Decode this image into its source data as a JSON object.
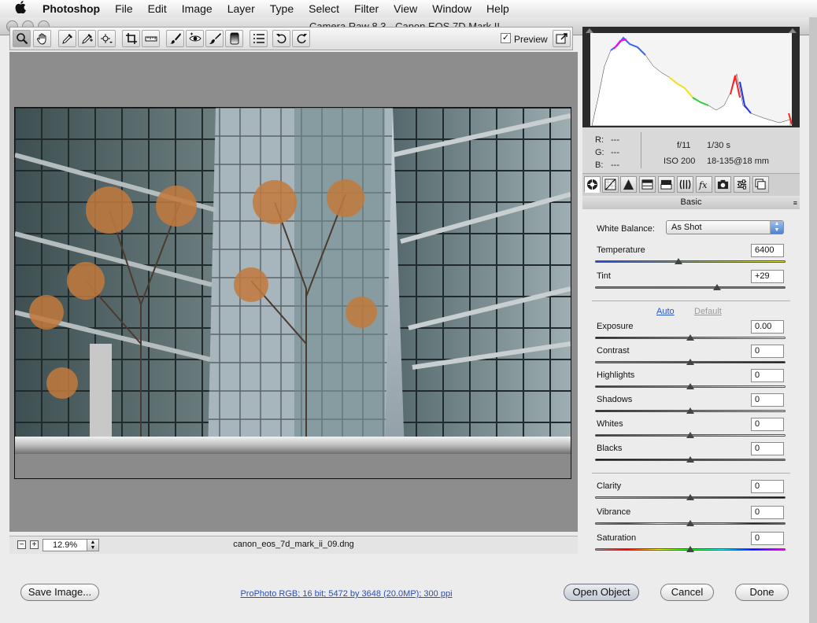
{
  "menubar": {
    "apple": "",
    "items": [
      "Photoshop",
      "File",
      "Edit",
      "Image",
      "Layer",
      "Type",
      "Select",
      "Filter",
      "View",
      "Window",
      "Help"
    ]
  },
  "window": {
    "title": "Camera Raw 8.3  -  Canon EOS 7D Mark II"
  },
  "toolbar": {
    "tools": [
      "zoom-tool",
      "hand-tool",
      "white-balance-tool",
      "color-sampler-tool",
      "targeted-adjustment-tool",
      "crop-tool",
      "straighten-tool",
      "spot-removal-tool",
      "red-eye-removal-tool",
      "adjustment-brush",
      "graduated-filter",
      "preferences",
      "rotate-left",
      "rotate-right"
    ],
    "preview_label": "Preview",
    "preview_checked": true
  },
  "status": {
    "zoom": "12.9%",
    "filename": "canon_eos_7d_mark_ii_09.dng"
  },
  "info": {
    "r_label": "R:",
    "r_value": "---",
    "g_label": "G:",
    "g_value": "---",
    "b_label": "B:",
    "b_value": "---",
    "aperture": "f/11",
    "shutter": "1/30 s",
    "iso": "ISO 200",
    "lens": "18-135@18 mm"
  },
  "panel": {
    "title": "Basic",
    "white_balance_label": "White Balance:",
    "white_balance_value": "As Shot",
    "auto": "Auto",
    "default": "Default",
    "sliders": [
      {
        "label": "Temperature",
        "value": "6400",
        "pos": 0.44
      },
      {
        "label": "Tint",
        "value": "+29",
        "pos": 0.64
      },
      {
        "label": "Exposure",
        "value": "0.00",
        "pos": 0.5
      },
      {
        "label": "Contrast",
        "value": "0",
        "pos": 0.5
      },
      {
        "label": "Highlights",
        "value": "0",
        "pos": 0.5
      },
      {
        "label": "Shadows",
        "value": "0",
        "pos": 0.5
      },
      {
        "label": "Whites",
        "value": "0",
        "pos": 0.5
      },
      {
        "label": "Blacks",
        "value": "0",
        "pos": 0.5
      },
      {
        "label": "Clarity",
        "value": "0",
        "pos": 0.5
      },
      {
        "label": "Vibrance",
        "value": "0",
        "pos": 0.5
      },
      {
        "label": "Saturation",
        "value": "0",
        "pos": 0.5
      }
    ]
  },
  "footer": {
    "save_image": "Save Image...",
    "profile": "ProPhoto RGB; 16 bit; 5472 by 3648 (20.0MP); 300 ppi",
    "open_object": "Open Object",
    "cancel": "Cancel",
    "done": "Done"
  },
  "colors": {
    "link": "#2a55c9",
    "temperature_track": [
      "#2448c8",
      "#e8e820"
    ],
    "tint_track": [
      "#2fb82f",
      "#d43bd4"
    ]
  }
}
